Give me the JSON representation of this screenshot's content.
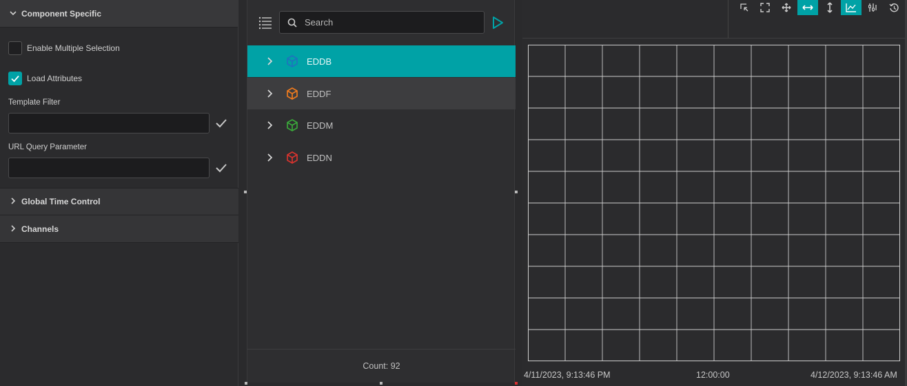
{
  "left_panel": {
    "component_specific": {
      "title": "Component Specific",
      "expanded": true
    },
    "enable_multiple_selection": {
      "label": "Enable Multiple Selection",
      "checked": false
    },
    "load_attributes": {
      "label": "Load Attributes",
      "checked": true
    },
    "template_filter": {
      "label": "Template Filter",
      "value": ""
    },
    "url_query_parameter": {
      "label": "URL Query Parameter",
      "value": ""
    },
    "global_time_control": {
      "title": "Global Time Control",
      "expanded": false
    },
    "channels": {
      "title": "Channels",
      "expanded": false
    }
  },
  "list_panel": {
    "search": {
      "placeholder": "Search",
      "value": ""
    },
    "items": [
      {
        "label": "EDDB",
        "icon": "cube-icon",
        "color": "#1e73be",
        "state": "selected"
      },
      {
        "label": "EDDF",
        "icon": "cube-icon",
        "color": "#f07b1e",
        "state": "hover"
      },
      {
        "label": "EDDM",
        "icon": "cube-icon",
        "color": "#3aa83a",
        "state": "normal"
      },
      {
        "label": "EDDN",
        "icon": "cube-icon",
        "color": "#d8332e",
        "state": "normal"
      }
    ],
    "count_label": "Count: 92"
  },
  "chart_panel": {
    "toolbar": [
      "lasso-select-icon",
      "fullscreen-icon",
      "pan-icon",
      "zoom-x-icon",
      "zoom-y-icon",
      "chart-line-icon",
      "settings-sliders-icon",
      "history-icon"
    ],
    "active_tools": [
      "zoom-x-icon",
      "chart-line-icon"
    ],
    "x_axis": {
      "start": "4/11/2023, 9:13:46 PM",
      "mid": "12:00:00",
      "end": "4/12/2023, 9:13:46 AM"
    }
  },
  "colors": {
    "accent": "#00a2a6",
    "background": "#2a2a2c"
  }
}
